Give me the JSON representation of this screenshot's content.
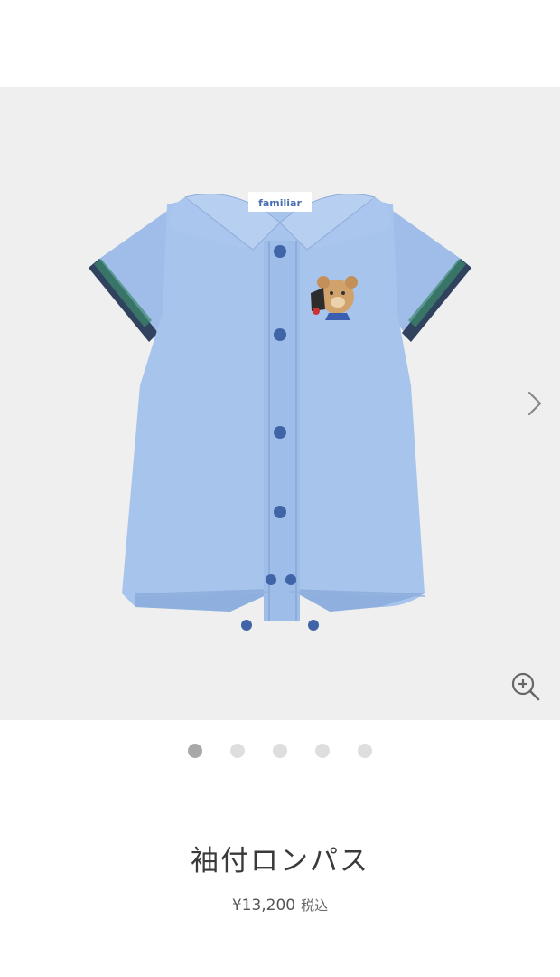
{
  "product": {
    "title": "袖付ロンパス",
    "price": "¥13,200",
    "tax_label": "税込",
    "brand_tag": "familiar"
  },
  "gallery": {
    "image_count": 5,
    "active_index": 0,
    "next_icon": "chevron-right-icon",
    "zoom_icon": "zoom-in-icon"
  },
  "colors": {
    "gallery_bg": "#efefef",
    "romper": "#a7c4ec",
    "buttons": "#3f64a8",
    "dot_active": "#a8a8a8",
    "dot_inactive": "#dedede"
  }
}
